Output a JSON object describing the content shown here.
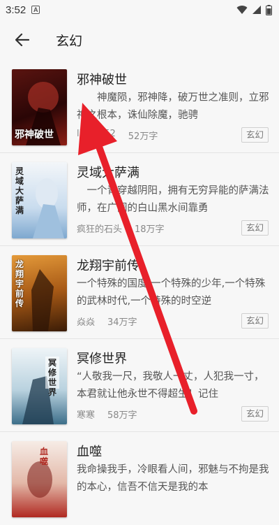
{
  "status_bar": {
    "time": "3:52",
    "notification_icon": "A"
  },
  "header": {
    "title": "玄幻"
  },
  "books": [
    {
      "title": "邪神破世",
      "description": "　　神魔陨，邪神降，破万世之准则，立邪神之根本，诛仙除魔，驰骋",
      "author": "lijin4752",
      "words": "52万字",
      "tag": "玄幻",
      "cover_text": "邪神破世",
      "cover_colors": [
        "#3a0d0d",
        "#8e1f16"
      ]
    },
    {
      "title": "灵域大萨满",
      "description": "　一个青穿越阴阳，拥有无穷异能的萨满法师，在广阔的白山黑水间靠勇",
      "author": "疯狂的石头",
      "words": "18万字",
      "tag": "玄幻",
      "cover_text": "灵域大萨满",
      "cover_colors": [
        "#e9eef4",
        "#7ea8cf"
      ]
    },
    {
      "title": "龙翔宇前传",
      "description": "一个特殊的国度,一个特殊的少年,一个特殊的武林时代,一个特殊的时空逆",
      "author": "焱焱",
      "words": "34万字",
      "tag": "玄幻",
      "cover_text": "龙翔宇前传",
      "cover_colors": [
        "#c6761e",
        "#4a2608"
      ]
    },
    {
      "title": "冥修世界",
      "description": "“人敬我一尺，我敬人一丈，人犯我一寸，本君就让他永世不得超生！记住",
      "author": "寒寒",
      "words": "58万字",
      "tag": "玄幻",
      "cover_text": "冥修世界",
      "cover_colors": [
        "#dbe7ee",
        "#3d6f8a"
      ]
    },
    {
      "title": "血噬",
      "description": "我命操我手，冷眼看人间，邪魅与不拘是我的本心，信吾不信天是我的本",
      "author": "",
      "words": "",
      "tag": "",
      "cover_text": "血噬",
      "cover_colors": [
        "#f1e2dc",
        "#b02a22"
      ]
    }
  ],
  "overlay_arrow": {
    "color": "#e8202a"
  }
}
